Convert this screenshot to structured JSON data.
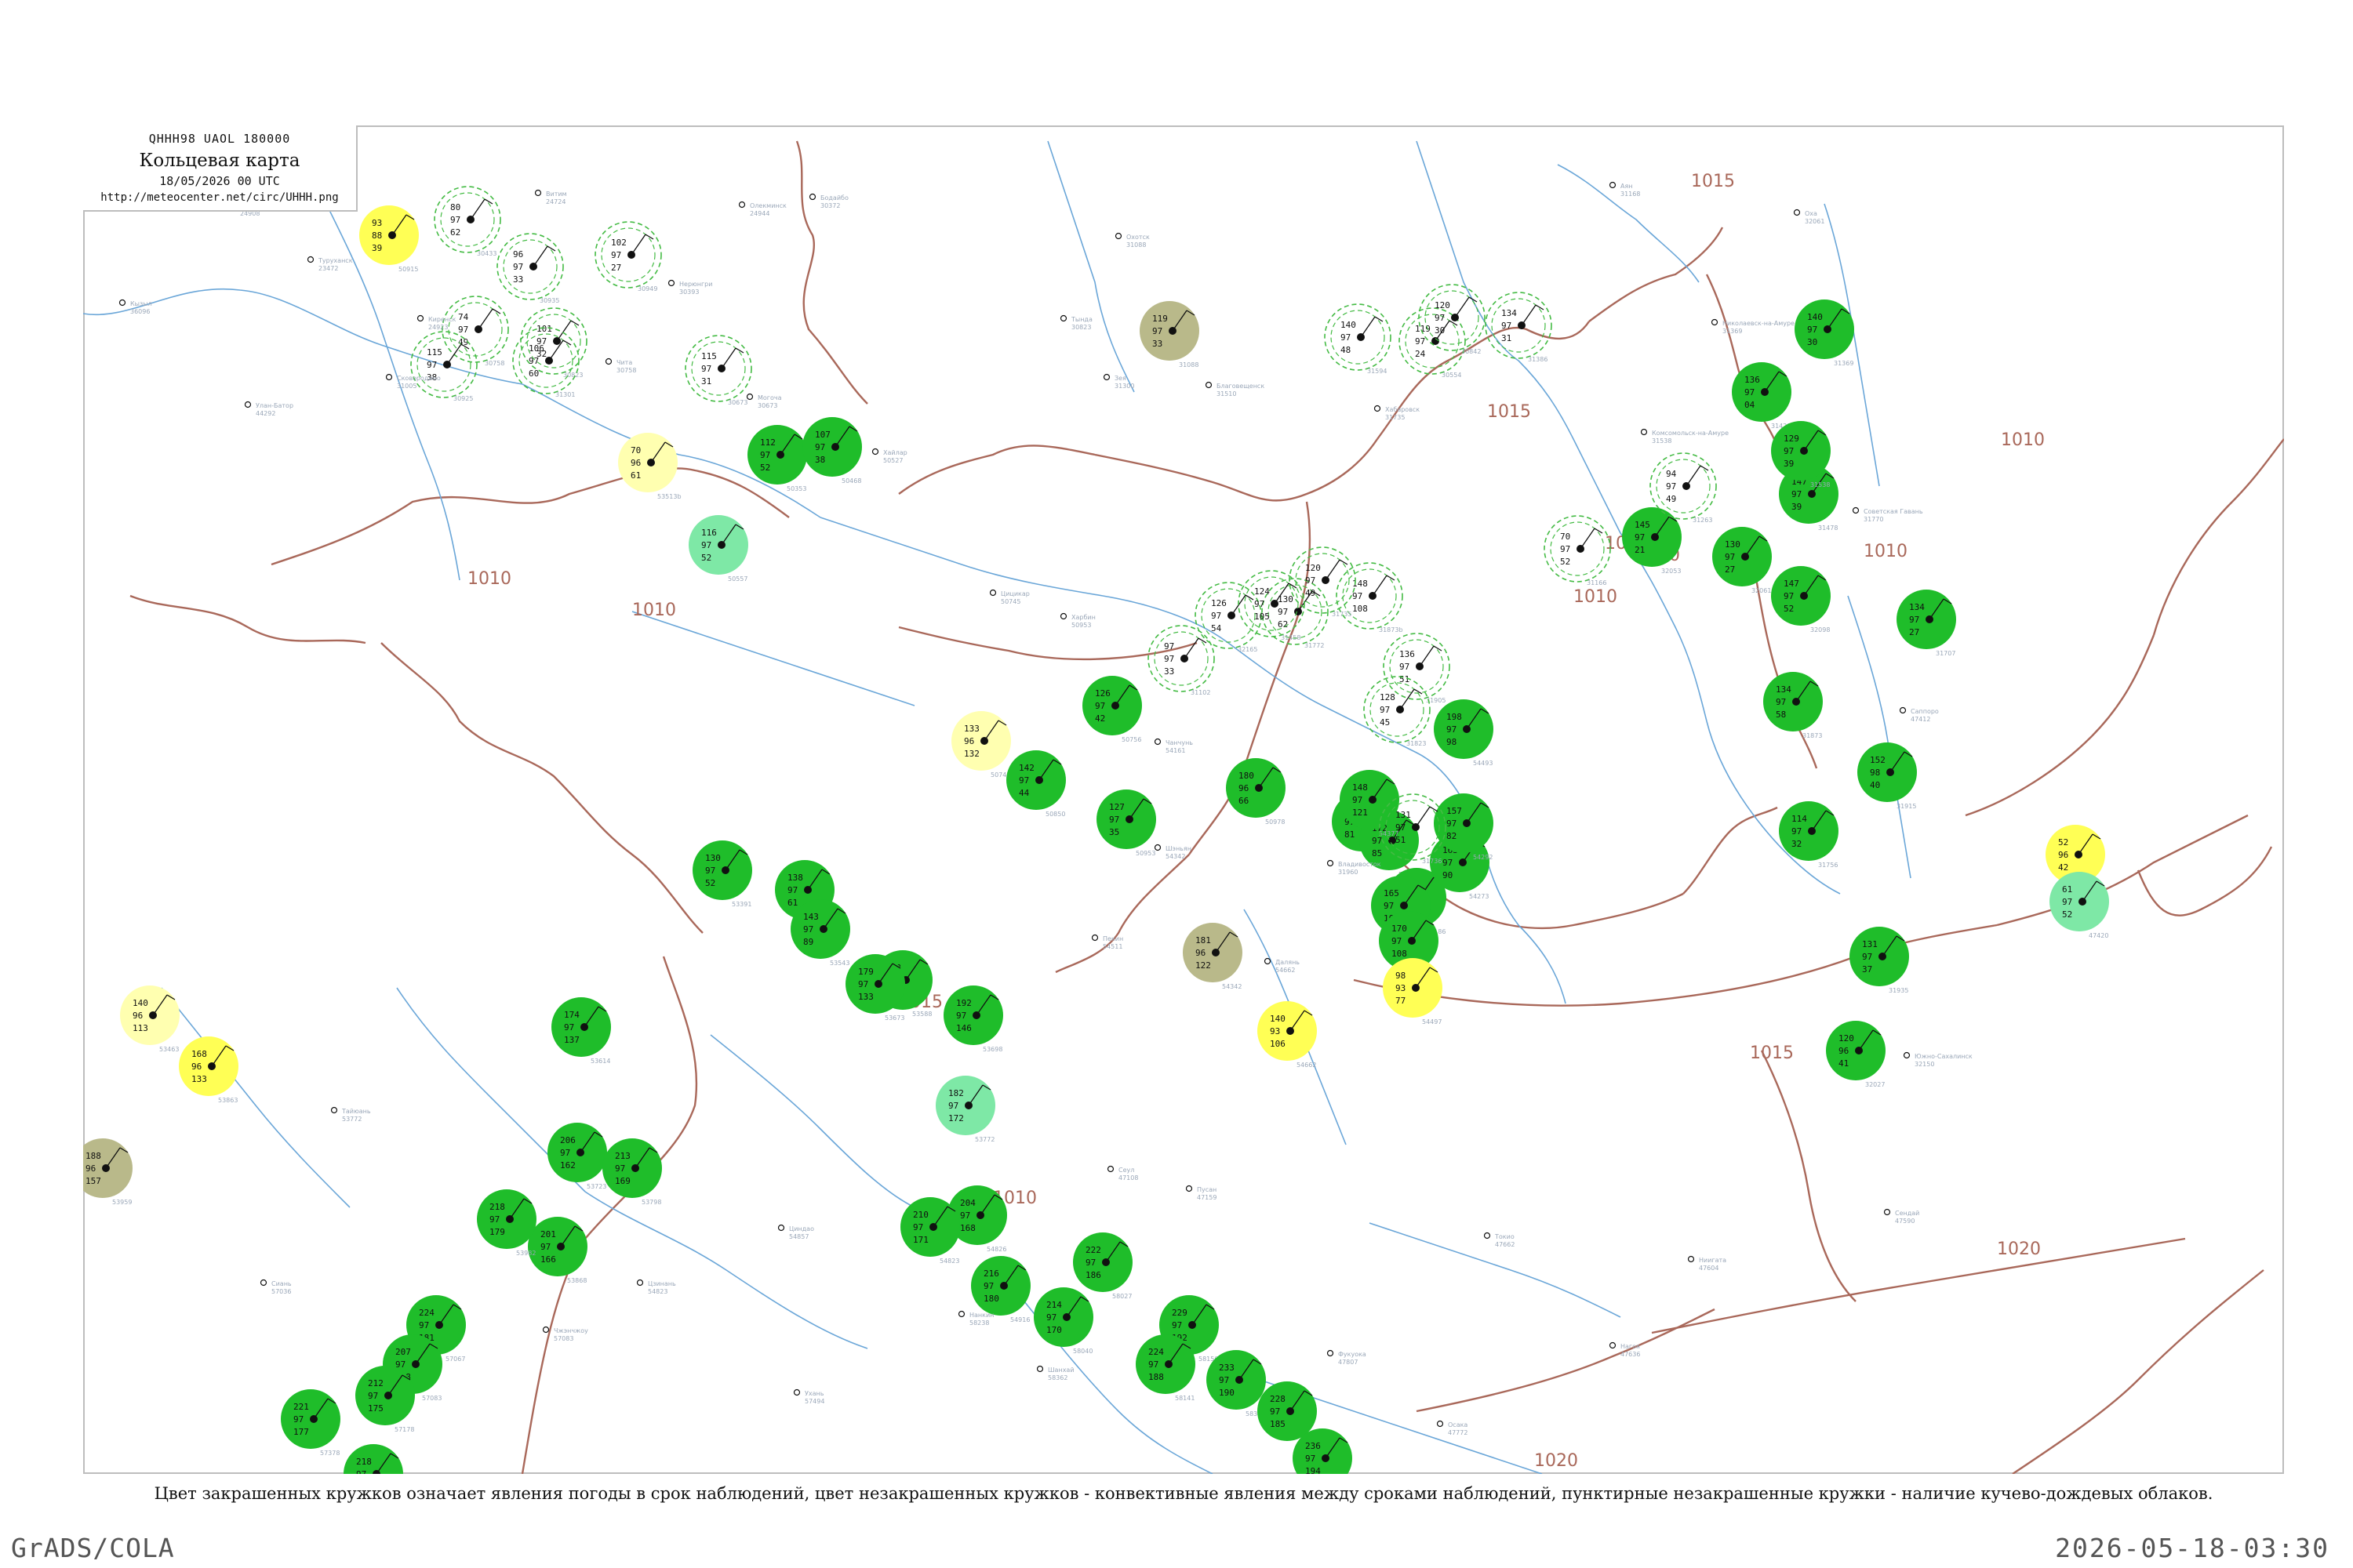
{
  "title_box": {
    "code": "QHHH98 UAOL 180000",
    "title": "Кольцевая карта",
    "date": "18/05/2026 00 UTC",
    "url": "http://meteocenter.net/circ/UHHH.png"
  },
  "legend_caption": "Цвет закрашенных кружков означает явления погоды в срок наблюдений, цвет незакрашенных кружков - конвективные явления между сроками наблюдений, пунктирные незакрашенные кружки - наличие кучево-дождевых облаков.",
  "footer": {
    "left": "GrADS/COLA",
    "right": "2026-05-18-03:30"
  },
  "colors": {
    "isobar": "#a9685a",
    "river": "#6aa6d8",
    "rain": "#1fbd2a",
    "showers": "#7ee8a6",
    "fog": "#b9b98a",
    "haze": "#ffff55",
    "mist": "#ffffb0",
    "cb_circle": "#44bb44",
    "frame": "#bdbdbd"
  },
  "isobars": [
    {
      "label": "1015"
    },
    {
      "label": "1015"
    },
    {
      "label": "1015"
    },
    {
      "label": "1015"
    },
    {
      "label": "1015"
    },
    {
      "label": "1010"
    },
    {
      "label": "1010"
    },
    {
      "label": "1010"
    },
    {
      "label": "1010"
    },
    {
      "label": "1010"
    },
    {
      "label": "1010"
    },
    {
      "label": "1010"
    },
    {
      "label": "1020"
    },
    {
      "label": "1020"
    },
    {
      "label": "1020"
    }
  ],
  "stations": [
    {
      "code": "31369",
      "temp": "140",
      "press": "97",
      "dew": "30",
      "weather": "rain"
    },
    {
      "code": "31421",
      "temp": "136",
      "press": "97",
      "dew": "04",
      "weather": "rain"
    },
    {
      "code": "31478",
      "temp": "147",
      "press": "97",
      "dew": "39",
      "weather": "rain"
    },
    {
      "code": "31538",
      "temp": "129",
      "press": "97",
      "dew": "39",
      "weather": "rain"
    },
    {
      "code": "31707",
      "temp": "134",
      "press": "97",
      "dew": "27",
      "weather": "rain"
    },
    {
      "code": "31915",
      "temp": "152",
      "press": "98",
      "dew": "40",
      "weather": "rain"
    },
    {
      "code": "31935",
      "temp": "131",
      "press": "97",
      "dew": "37",
      "weather": "rain"
    },
    {
      "code": "32027",
      "temp": "120",
      "press": "96",
      "dew": "41",
      "weather": "rain"
    },
    {
      "code": "31756",
      "temp": "114",
      "press": "97",
      "dew": "32",
      "weather": "rain"
    },
    {
      "code": "31873",
      "temp": "134",
      "press": "97",
      "dew": "58",
      "weather": "rain"
    },
    {
      "code": "50353",
      "temp": "112",
      "press": "97",
      "dew": "52",
      "weather": "rain"
    },
    {
      "code": "50468",
      "temp": "107",
      "press": "97",
      "dew": "38",
      "weather": "rain"
    },
    {
      "code": "50557",
      "temp": "116",
      "press": "97",
      "dew": "52",
      "weather": "showers"
    },
    {
      "code": "50742",
      "temp": "133",
      "press": "96",
      "dew": "132",
      "weather": "mist"
    },
    {
      "code": "50756",
      "temp": "126",
      "press": "97",
      "dew": "42",
      "weather": "rain"
    },
    {
      "code": "50850",
      "temp": "142",
      "press": "97",
      "dew": "44",
      "weather": "rain"
    },
    {
      "code": "50953",
      "temp": "127",
      "press": "97",
      "dew": "35",
      "weather": "rain"
    },
    {
      "code": "50978",
      "temp": "180",
      "press": "96",
      "dew": "66",
      "weather": "rain"
    },
    {
      "code": "54094",
      "temp": "151",
      "press": "97",
      "dew": "81",
      "weather": "rain"
    },
    {
      "code": "54161",
      "temp": "172",
      "press": "97",
      "dew": "85",
      "weather": "rain"
    },
    {
      "code": "54186",
      "temp": "176",
      "press": "97",
      "dew": "94",
      "weather": "rain"
    },
    {
      "code": "54273",
      "temp": "163",
      "press": "97",
      "dew": "90",
      "weather": "rain"
    },
    {
      "code": "54292",
      "temp": "157",
      "press": "97",
      "dew": "82",
      "weather": "rain"
    },
    {
      "code": "54342",
      "temp": "181",
      "press": "96",
      "dew": "122",
      "weather": "fog"
    },
    {
      "code": "54363",
      "temp": "165",
      "press": "97",
      "dew": "101",
      "weather": "rain"
    },
    {
      "code": "54374",
      "temp": "170",
      "press": "97",
      "dew": "108",
      "weather": "rain"
    },
    {
      "code": "54377",
      "temp": "148",
      "press": "97",
      "dew": "121",
      "weather": "rain"
    },
    {
      "code": "54493",
      "temp": "198",
      "press": "97",
      "dew": "98",
      "weather": "rain"
    },
    {
      "code": "54497",
      "temp": "98",
      "press": "93",
      "dew": "77",
      "weather": "haze"
    },
    {
      "code": "54662",
      "temp": "140",
      "press": "93",
      "dew": "106",
      "weather": "haze"
    },
    {
      "code": "53391",
      "temp": "130",
      "press": "97",
      "dew": "52",
      "weather": "rain"
    },
    {
      "code": "53513",
      "temp": "138",
      "press": "97",
      "dew": "61",
      "weather": "rain"
    },
    {
      "code": "53543",
      "temp": "143",
      "press": "97",
      "dew": "89",
      "weather": "rain"
    },
    {
      "code": "53588",
      "temp": "168",
      "press": "97",
      "dew": "120",
      "weather": "rain"
    },
    {
      "code": "53673",
      "temp": "179",
      "press": "97",
      "dew": "133",
      "weather": "rain"
    },
    {
      "code": "53698",
      "temp": "192",
      "press": "97",
      "dew": "146",
      "weather": "rain"
    },
    {
      "code": "53772",
      "temp": "182",
      "press": "97",
      "dew": "172",
      "weather": "showers"
    },
    {
      "code": "53863",
      "temp": "168",
      "press": "96",
      "dew": "133",
      "weather": "haze"
    },
    {
      "code": "53959",
      "temp": "188",
      "press": "96",
      "dew": "157",
      "weather": "fog"
    },
    {
      "code": "53463",
      "temp": "140",
      "press": "96",
      "dew": "113",
      "weather": "mist"
    },
    {
      "code": "53614",
      "temp": "174",
      "press": "97",
      "dew": "137",
      "weather": "rain"
    },
    {
      "code": "53723",
      "temp": "206",
      "press": "97",
      "dew": "162",
      "weather": "rain"
    },
    {
      "code": "53798",
      "temp": "213",
      "press": "97",
      "dew": "169",
      "weather": "rain"
    },
    {
      "code": "53868",
      "temp": "201",
      "press": "97",
      "dew": "166",
      "weather": "rain"
    },
    {
      "code": "53982",
      "temp": "218",
      "press": "97",
      "dew": "179",
      "weather": "rain"
    },
    {
      "code": "57067",
      "temp": "224",
      "press": "97",
      "dew": "181",
      "weather": "rain"
    },
    {
      "code": "57083",
      "temp": "207",
      "press": "97",
      "dew": "168",
      "weather": "rain"
    },
    {
      "code": "57178",
      "temp": "212",
      "press": "97",
      "dew": "175",
      "weather": "rain"
    },
    {
      "code": "57290",
      "temp": "218",
      "press": "97",
      "dew": "184",
      "weather": "rain"
    },
    {
      "code": "57378",
      "temp": "221",
      "press": "97",
      "dew": "177",
      "weather": "rain"
    },
    {
      "code": "54826",
      "temp": "204",
      "press": "97",
      "dew": "168",
      "weather": "rain"
    },
    {
      "code": "54823",
      "temp": "210",
      "press": "97",
      "dew": "171",
      "weather": "rain"
    },
    {
      "code": "54916",
      "temp": "216",
      "press": "97",
      "dew": "180",
      "weather": "rain"
    },
    {
      "code": "58027",
      "temp": "222",
      "press": "97",
      "dew": "186",
      "weather": "rain"
    },
    {
      "code": "58040",
      "temp": "214",
      "press": "97",
      "dew": "170",
      "weather": "rain"
    },
    {
      "code": "58150",
      "temp": "229",
      "press": "97",
      "dew": "192",
      "weather": "rain"
    },
    {
      "code": "58141",
      "temp": "224",
      "press": "97",
      "dew": "188",
      "weather": "rain"
    },
    {
      "code": "58314",
      "temp": "233",
      "press": "97",
      "dew": "190",
      "weather": "rain"
    },
    {
      "code": "58321",
      "temp": "228",
      "press": "97",
      "dew": "185",
      "weather": "rain"
    },
    {
      "code": "58424",
      "temp": "236",
      "press": "97",
      "dew": "194",
      "weather": "rain"
    },
    {
      "code": "47401",
      "temp": "52",
      "press": "96",
      "dew": "42",
      "weather": "haze"
    },
    {
      "code": "47420",
      "temp": "61",
      "press": "97",
      "dew": "52",
      "weather": "showers"
    },
    {
      "code": "31088",
      "temp": "119",
      "press": "97",
      "dew": "33",
      "weather": "fog"
    },
    {
      "code": "53513b",
      "temp": "70",
      "press": "96",
      "dew": "61",
      "weather": "mist"
    },
    {
      "code": "50915",
      "temp": "93",
      "press": "88",
      "dew": "39",
      "weather": "haze"
    },
    {
      "code": "32053",
      "temp": "145",
      "press": "97",
      "dew": "21",
      "weather": "rain"
    },
    {
      "code": "32061",
      "temp": "130",
      "press": "97",
      "dew": "27",
      "weather": "rain"
    },
    {
      "code": "32098",
      "temp": "147",
      "press": "97",
      "dew": "52",
      "weather": "rain"
    },
    {
      "code": "31736",
      "temp": "131",
      "press": "97",
      "dew": "51",
      "weather": "cb"
    },
    {
      "code": "31873b",
      "temp": "148",
      "press": "97",
      "dew": "108",
      "weather": "cb"
    },
    {
      "code": "31905",
      "temp": "136",
      "press": "97",
      "dew": "51",
      "weather": "cb"
    },
    {
      "code": "31823",
      "temp": "128",
      "press": "97",
      "dew": "45",
      "weather": "cb"
    },
    {
      "code": "31772",
      "temp": "130",
      "press": "97",
      "dew": "62",
      "weather": "cb"
    },
    {
      "code": "32165",
      "temp": "126",
      "press": "97",
      "dew": "54",
      "weather": "cb"
    },
    {
      "code": "31735",
      "temp": "120",
      "press": "97",
      "dew": "49",
      "weather": "cb"
    },
    {
      "code": "31594",
      "temp": "140",
      "press": "97",
      "dew": "48",
      "weather": "cb"
    },
    {
      "code": "30554",
      "temp": "119",
      "press": "97",
      "dew": "24",
      "weather": "cb"
    },
    {
      "code": "30673",
      "temp": "115",
      "press": "97",
      "dew": "31",
      "weather": "cb"
    },
    {
      "code": "30758",
      "temp": "74",
      "press": "97",
      "dew": "49",
      "weather": "cb"
    },
    {
      "code": "30823",
      "temp": "101",
      "press": "97",
      "dew": "32",
      "weather": "cb"
    },
    {
      "code": "30925",
      "temp": "115",
      "press": "97",
      "dew": "38",
      "weather": "cb"
    },
    {
      "code": "30935",
      "temp": "96",
      "press": "97",
      "dew": "33",
      "weather": "cb"
    },
    {
      "code": "30949",
      "temp": "102",
      "press": "97",
      "dew": "27",
      "weather": "cb"
    },
    {
      "code": "31301",
      "temp": "106",
      "press": "97",
      "dew": "60",
      "weather": "cb"
    },
    {
      "code": "30433",
      "temp": "80",
      "press": "97",
      "dew": "62",
      "weather": "cb"
    },
    {
      "code": "31263",
      "temp": "94",
      "press": "97",
      "dew": "49",
      "weather": "cb"
    },
    {
      "code": "31166",
      "temp": "70",
      "press": "97",
      "dew": "52",
      "weather": "cb"
    },
    {
      "code": "31386",
      "temp": "134",
      "press": "97",
      "dew": "31",
      "weather": "cb"
    },
    {
      "code": "31458",
      "temp": "124",
      "press": "97",
      "dew": "105",
      "weather": "cb"
    },
    {
      "code": "30842",
      "temp": "120",
      "press": "97",
      "dew": "30",
      "weather": "cb"
    },
    {
      "code": "31102",
      "temp": "97",
      "press": "97",
      "dew": "33",
      "weather": "cb"
    }
  ],
  "station_labels": [
    {
      "name": "Ванавара",
      "code": "24908"
    },
    {
      "name": "Туруханск",
      "code": "23472"
    },
    {
      "name": "Киренск",
      "code": "24923"
    },
    {
      "name": "Витим",
      "code": "24724"
    },
    {
      "name": "Олекминск",
      "code": "24944"
    },
    {
      "name": "Нерюнгри",
      "code": "30393"
    },
    {
      "name": "Бодайбо",
      "code": "30372"
    },
    {
      "name": "Чита",
      "code": "30758"
    },
    {
      "name": "Могоча",
      "code": "30673"
    },
    {
      "name": "Сковородино",
      "code": "31005"
    },
    {
      "name": "Тында",
      "code": "30823"
    },
    {
      "name": "Зея",
      "code": "31300"
    },
    {
      "name": "Благовещенск",
      "code": "31510"
    },
    {
      "name": "Хабаровск",
      "code": "31735"
    },
    {
      "name": "Николаевск-на-Амуре",
      "code": "31369"
    },
    {
      "name": "Комсомольск-на-Амуре",
      "code": "31538"
    },
    {
      "name": "Советская Гавань",
      "code": "31770"
    },
    {
      "name": "Охотск",
      "code": "31088"
    },
    {
      "name": "Аян",
      "code": "31168"
    },
    {
      "name": "Улан-Батор",
      "code": "44292"
    },
    {
      "name": "Кызыл",
      "code": "36096"
    },
    {
      "name": "Хайлар",
      "code": "50527"
    },
    {
      "name": "Харбин",
      "code": "50953"
    },
    {
      "name": "Цицикар",
      "code": "50745"
    },
    {
      "name": "Чанчунь",
      "code": "54161"
    },
    {
      "name": "Шэньян",
      "code": "54342"
    },
    {
      "name": "Пекин",
      "code": "54511"
    },
    {
      "name": "Далянь",
      "code": "54662"
    },
    {
      "name": "Владивосток",
      "code": "31960"
    },
    {
      "name": "Сеул",
      "code": "47108"
    },
    {
      "name": "Пусан",
      "code": "47159"
    },
    {
      "name": "Токио",
      "code": "47662"
    },
    {
      "name": "Саппоро",
      "code": "47412"
    },
    {
      "name": "Южно-Сахалинск",
      "code": "32150"
    },
    {
      "name": "Оха",
      "code": "32061"
    },
    {
      "name": "Тайюань",
      "code": "53772"
    },
    {
      "name": "Сиань",
      "code": "57036"
    },
    {
      "name": "Чжэнчжоу",
      "code": "57083"
    },
    {
      "name": "Цзинань",
      "code": "54823"
    },
    {
      "name": "Циндао",
      "code": "54857"
    },
    {
      "name": "Шанхай",
      "code": "58362"
    },
    {
      "name": "Нанкин",
      "code": "58238"
    },
    {
      "name": "Ухань",
      "code": "57494"
    },
    {
      "name": "Фукуока",
      "code": "47807"
    },
    {
      "name": "Осака",
      "code": "47772"
    },
    {
      "name": "Нагоя",
      "code": "47636"
    },
    {
      "name": "Ниигата",
      "code": "47604"
    },
    {
      "name": "Сендай",
      "code": "47590"
    }
  ]
}
